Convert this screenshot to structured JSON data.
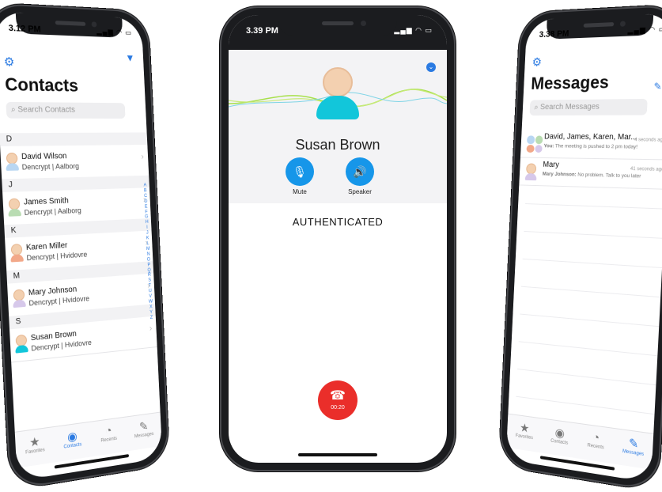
{
  "colors": {
    "accent": "#2a7ae2",
    "call_button": "#1696e9",
    "hangup": "#ea2e2a",
    "frame": "#1b1c1f"
  },
  "phone_contacts": {
    "status_time": "3.12 PM",
    "settings_icon": "gear-icon",
    "filter_icon": "filter-icon",
    "title": "Contacts",
    "search_placeholder": "Search Contacts",
    "sections": [
      {
        "letter": "D",
        "contacts": [
          {
            "name": "David Wilson",
            "org": "Dencrypt | Aalborg",
            "avatar_color": "#b8d6f2"
          }
        ]
      },
      {
        "letter": "J",
        "contacts": [
          {
            "name": "James Smith",
            "org": "Dencrypt | Aalborg",
            "avatar_color": "#b9dcb2"
          }
        ]
      },
      {
        "letter": "K",
        "contacts": [
          {
            "name": "Karen Miller",
            "org": "Dencrypt | Hvidovre",
            "avatar_color": "#f2a889"
          }
        ]
      },
      {
        "letter": "M",
        "contacts": [
          {
            "name": "Mary Johnson",
            "org": "Dencrypt | Hvidovre",
            "avatar_color": "#d6c8ea"
          }
        ]
      },
      {
        "letter": "S",
        "contacts": [
          {
            "name": "Susan Brown",
            "org": "Dencrypt | Hvidovre",
            "avatar_color": "#12c6da"
          }
        ]
      }
    ],
    "index_letters": [
      "A",
      "B",
      "C",
      "D",
      "E",
      "F",
      "G",
      "H",
      "I",
      "J",
      "K",
      "L",
      "M",
      "N",
      "O",
      "P",
      "Q",
      "R",
      "S",
      "T",
      "U",
      "V",
      "W",
      "X",
      "Y",
      "Z"
    ],
    "tabs": [
      {
        "label": "Favorites",
        "icon": "star-icon",
        "glyph": "★",
        "active": false
      },
      {
        "label": "Contacts",
        "icon": "contacts-icon",
        "glyph": "◉",
        "active": true
      },
      {
        "label": "Recents",
        "icon": "clock-icon",
        "glyph": "◔",
        "active": false
      },
      {
        "label": "Messages",
        "icon": "compose-icon",
        "glyph": "✎",
        "active": false
      }
    ]
  },
  "phone_call": {
    "status_time": "3.39 PM",
    "collapse_icon": "chevron-down-icon",
    "callee": "Susan Brown",
    "mute_label": "Mute",
    "speaker_label": "Speaker",
    "status": "AUTHENTICATED",
    "timer": "00:20"
  },
  "phone_messages": {
    "status_time": "3.38 PM",
    "title": "Messages",
    "search_placeholder": "Search Messages",
    "threads": [
      {
        "name": "David, James, Karen, Mar...",
        "preview_sender": "You:",
        "preview": "The meeting is pushed to 2 pm today!",
        "time": "4 seconds ago"
      },
      {
        "name": "Mary",
        "preview_sender": "Mary Johnson:",
        "preview": "No problem. Talk to you later",
        "time": "41 seconds ago"
      }
    ],
    "tabs": [
      {
        "label": "Favorites",
        "glyph": "★",
        "active": false
      },
      {
        "label": "Contacts",
        "glyph": "◉",
        "active": false
      },
      {
        "label": "Recents",
        "glyph": "◔",
        "active": false
      },
      {
        "label": "Messages",
        "glyph": "✎",
        "active": true
      }
    ]
  }
}
